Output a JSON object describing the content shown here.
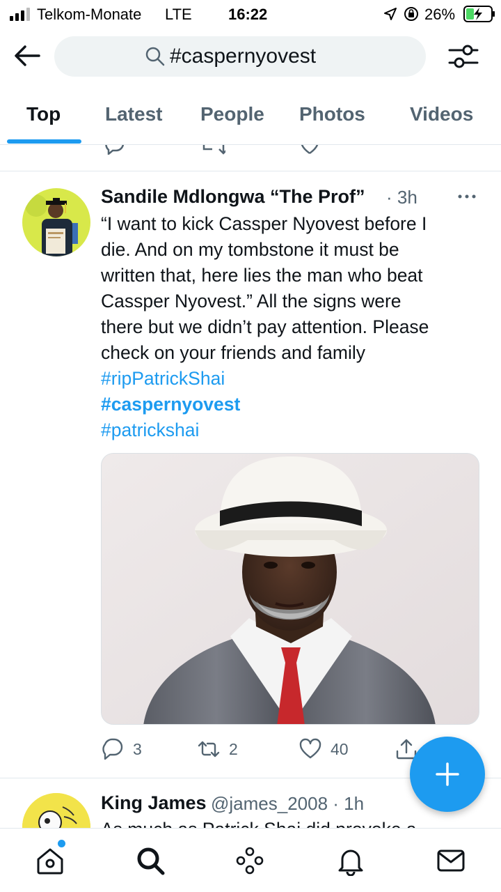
{
  "status_bar": {
    "carrier": "Telkom-Monate",
    "network": "LTE",
    "time": "16:22",
    "battery": "26%"
  },
  "search": {
    "query": "#caspernyovest"
  },
  "tabs": [
    {
      "label": "Top",
      "active": true
    },
    {
      "label": "Latest",
      "active": false
    },
    {
      "label": "People",
      "active": false
    },
    {
      "label": "Photos",
      "active": false
    },
    {
      "label": "Videos",
      "active": false
    }
  ],
  "tweet": {
    "author_name": "Sandile Mdlongwa “The Prof”",
    "meta": "· 3h",
    "text_lines": [
      "“I want to kick Cassper Nyovest before I",
      "die. And on my tombstone it must be",
      "written that, here lies the man who beat",
      "Cassper Nyovest.” All the signs were",
      "there but we didn’t pay attention. Please",
      "check on your friends and family"
    ],
    "hashtags": [
      "#ripPatrickShai",
      "#caspernyovest",
      "#patrickshai"
    ],
    "replies": "3",
    "retweets": "2",
    "likes": "40"
  },
  "next_tweet": {
    "author_name": "King James",
    "handle_meta": "@james_2008 · 1h",
    "text_partial": "As much as Patrick Shai did provoke a"
  },
  "colors": {
    "accent": "#1d9bf0",
    "text_primary": "#0f1419",
    "text_secondary": "#536471",
    "search_bg": "#eff3f4"
  },
  "icons": {
    "back": "arrow-left-icon",
    "search": "search-icon",
    "filter": "sliders-icon",
    "reply": "comment-icon",
    "retweet": "retweet-icon",
    "like": "heart-icon",
    "share": "share-icon",
    "compose": "plus-icon",
    "nav": [
      "home-icon",
      "search-icon",
      "spaces-icon",
      "bell-icon",
      "mail-icon"
    ]
  }
}
